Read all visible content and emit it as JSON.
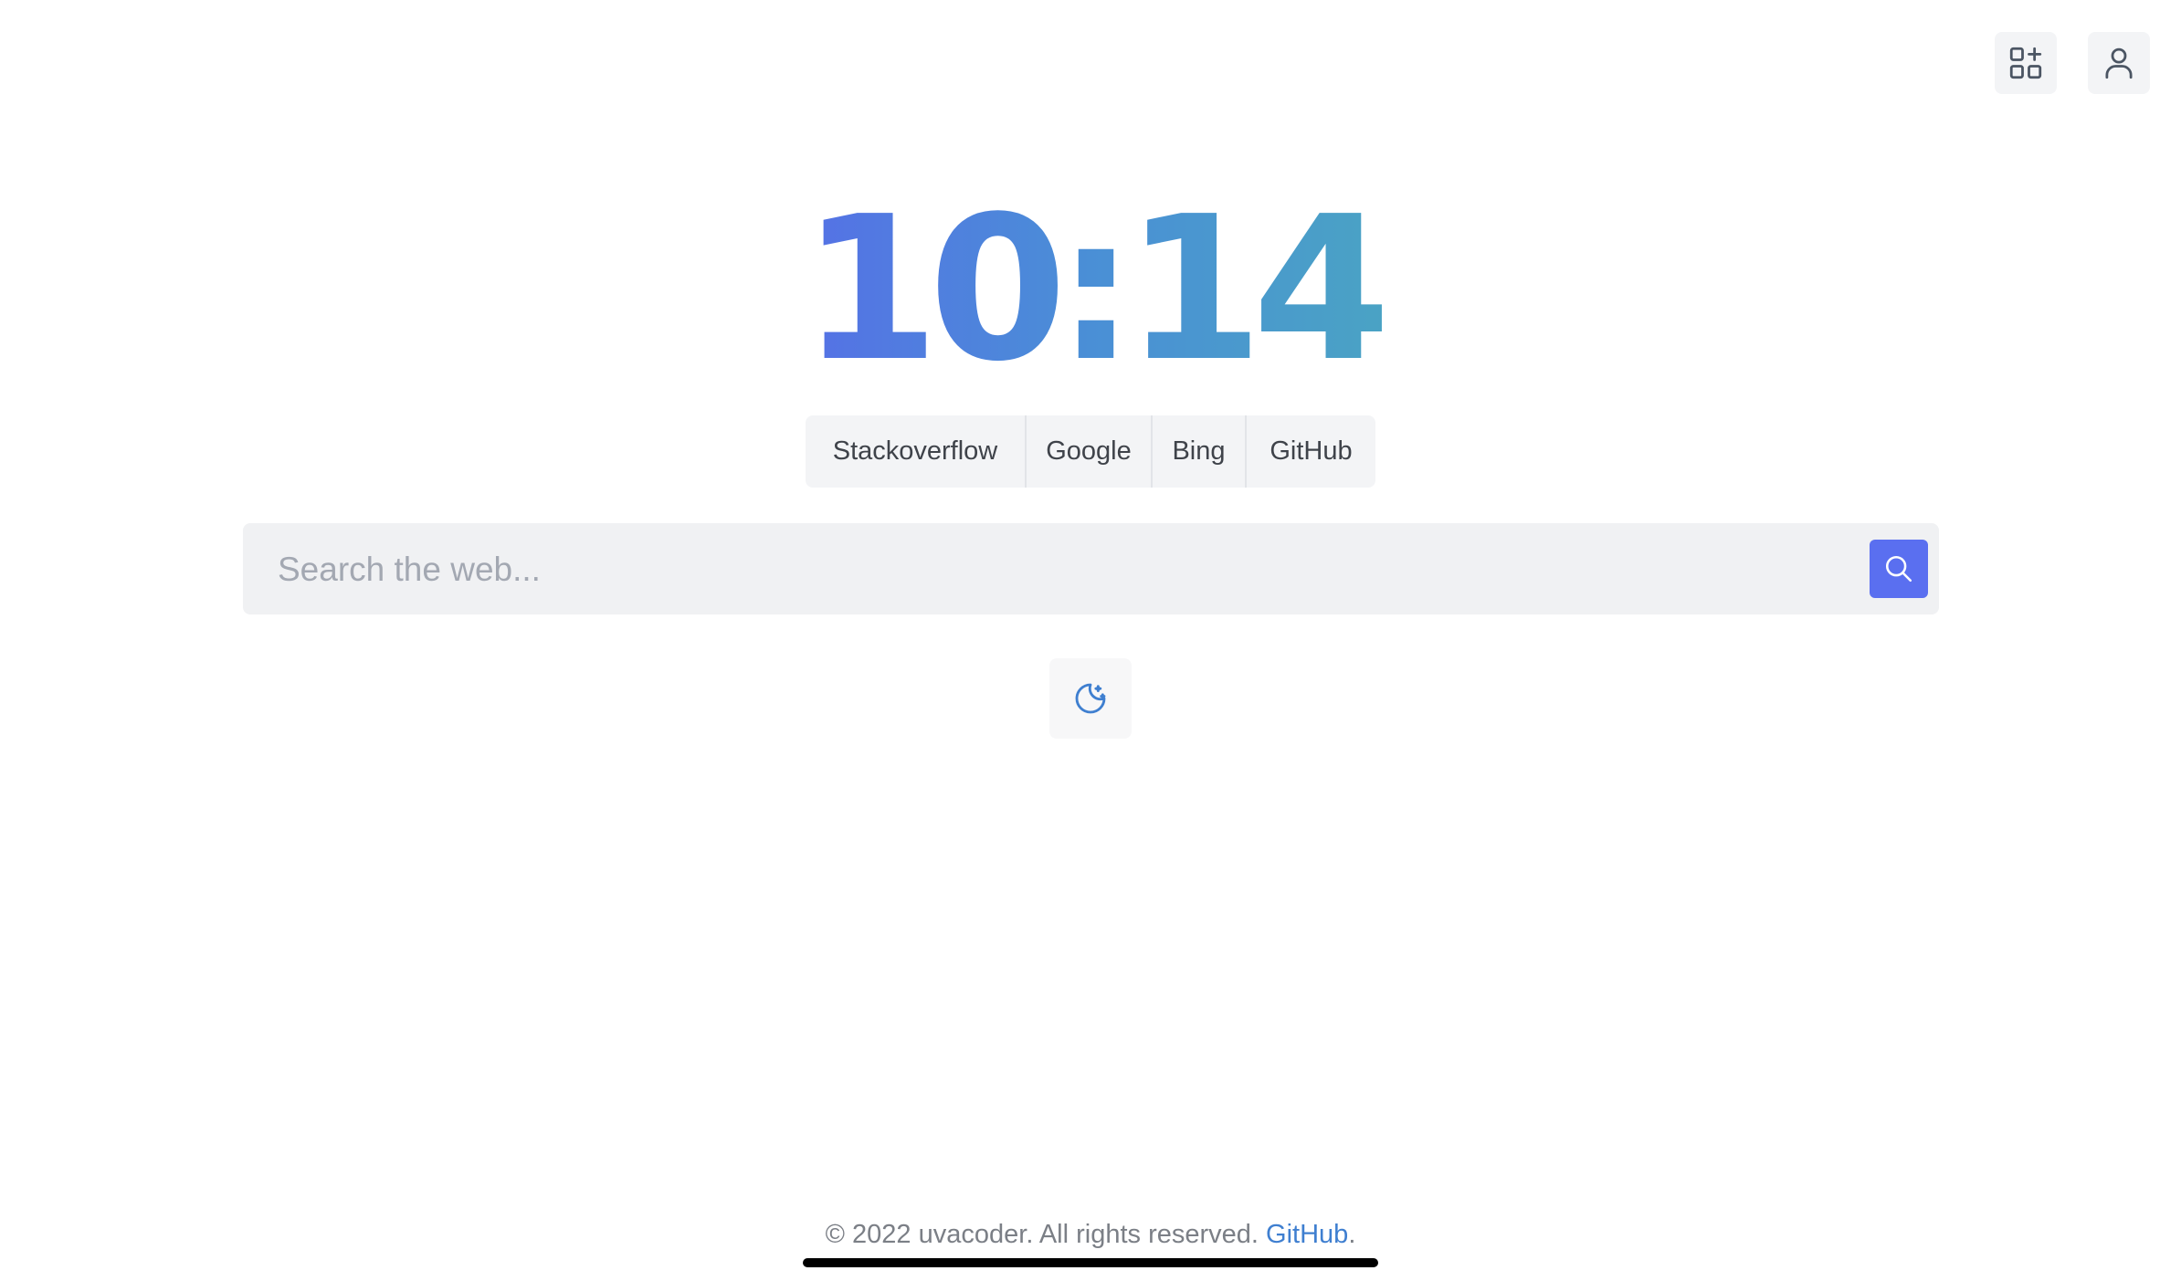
{
  "top_buttons": {
    "widgets_icon": "add-widget-icon",
    "profile_icon": "user-icon"
  },
  "clock": {
    "time": "10:14",
    "gradient_start": "#5570e6",
    "gradient_end": "#4aa3c4"
  },
  "engines": [
    {
      "label": "Stackoverflow"
    },
    {
      "label": "Google"
    },
    {
      "label": "Bing"
    },
    {
      "label": "GitHub"
    }
  ],
  "search": {
    "placeholder": "Search the web...",
    "value": "",
    "button_icon": "search-icon",
    "button_color": "#5a6ff0"
  },
  "theme_toggle": {
    "icon": "moon-stars-icon",
    "icon_color": "#3f7fd0"
  },
  "footer": {
    "text": "© 2022 uvacoder. All rights reserved. ",
    "link_label": "GitHub",
    "trailing": ".",
    "link_color": "#3f7fd0"
  }
}
